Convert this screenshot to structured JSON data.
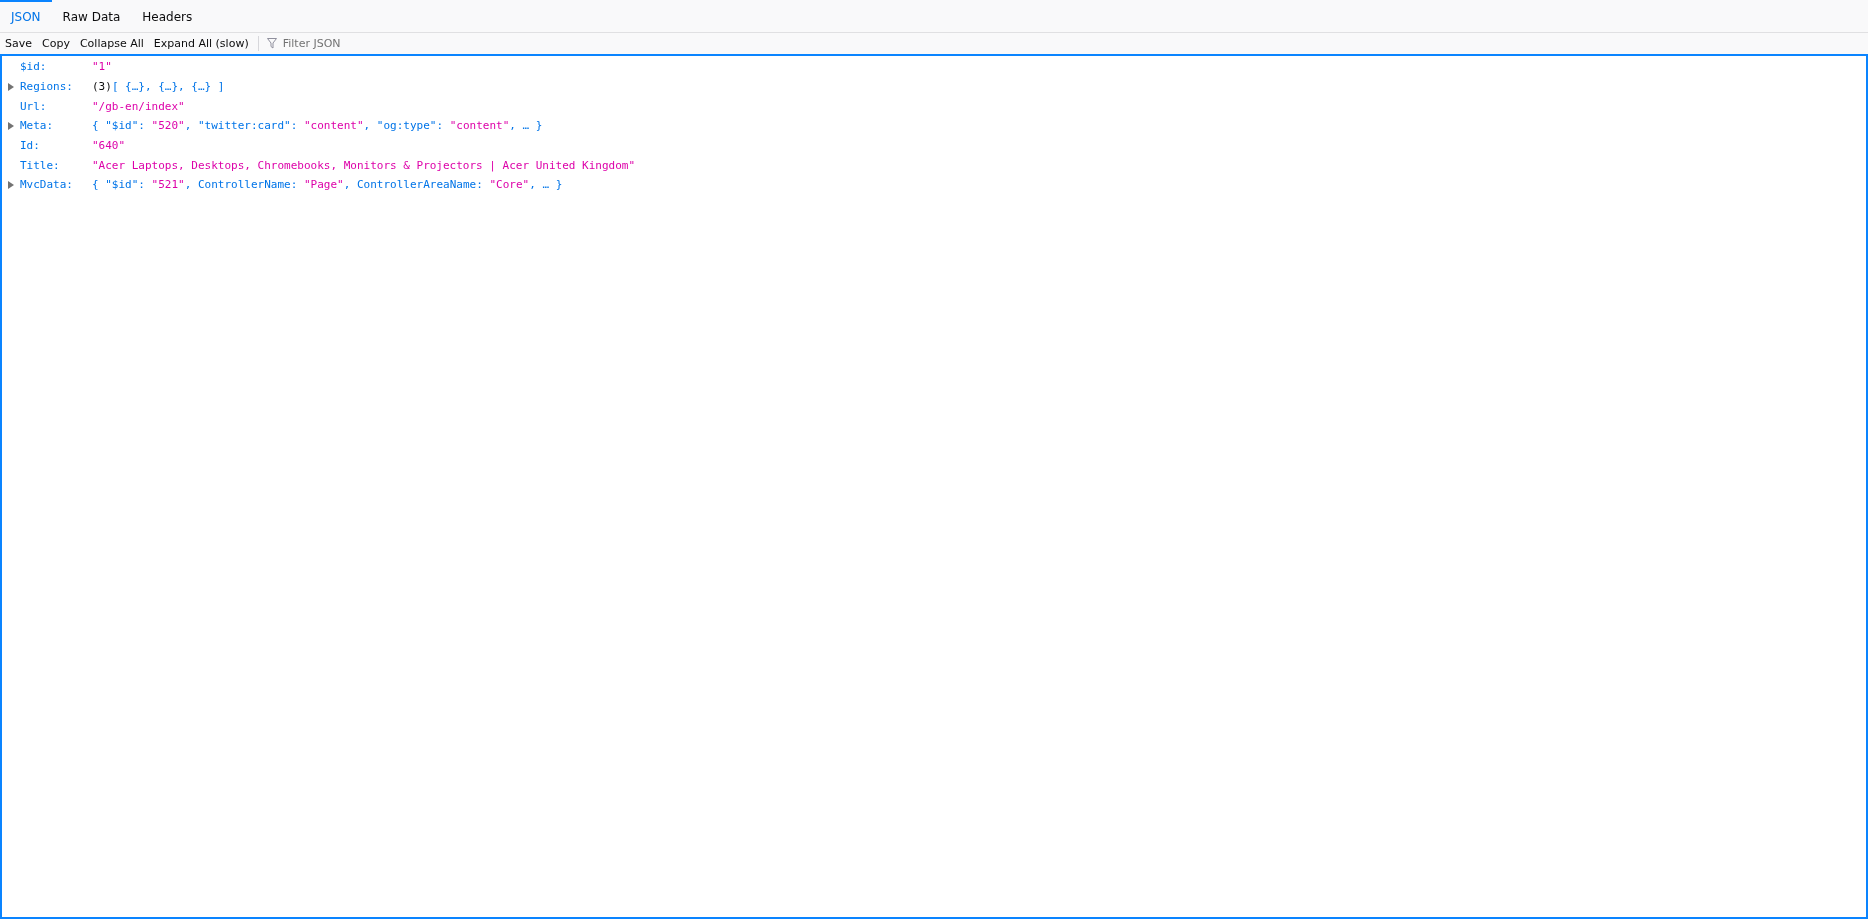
{
  "tabs": [
    {
      "label": "JSON",
      "selected": true
    },
    {
      "label": "Raw Data",
      "selected": false
    },
    {
      "label": "Headers",
      "selected": false
    }
  ],
  "toolbar": {
    "buttons": [
      "Save",
      "Copy",
      "Collapse All",
      "Expand All (slow)"
    ],
    "filter": {
      "placeholder": "Filter JSON"
    }
  },
  "rows": [
    {
      "key": "$id:",
      "kind": "leaf",
      "value": [
        {
          "kind": "string",
          "text": "\"1\""
        }
      ]
    },
    {
      "key": "Regions:",
      "kind": "object",
      "expanded": false,
      "value": [
        {
          "kind": "plain",
          "text": "(3)"
        },
        {
          "kind": "punct",
          "text": "[ {…}, {…}, {…} ]"
        }
      ]
    },
    {
      "key": "Url:",
      "kind": "leaf",
      "value": [
        {
          "kind": "string",
          "text": "\"/gb-en/index\""
        }
      ]
    },
    {
      "key": "Meta:",
      "kind": "object",
      "expanded": false,
      "value": [
        {
          "kind": "punct",
          "text": "{ \"$id\": "
        },
        {
          "kind": "string",
          "text": "\"520\""
        },
        {
          "kind": "punct",
          "text": ", \"twitter:card\": "
        },
        {
          "kind": "string",
          "text": "\"content\""
        },
        {
          "kind": "punct",
          "text": ", \"og:type\": "
        },
        {
          "kind": "string",
          "text": "\"content\""
        },
        {
          "kind": "punct",
          "text": ", … }"
        }
      ]
    },
    {
      "key": "Id:",
      "kind": "leaf",
      "value": [
        {
          "kind": "string",
          "text": "\"640\""
        }
      ]
    },
    {
      "key": "Title:",
      "kind": "leaf",
      "value": [
        {
          "kind": "string",
          "text": "\"Acer Laptops, Desktops, Chromebooks, Monitors & Projectors | Acer United Kingdom\""
        }
      ]
    },
    {
      "key": "MvcData:",
      "kind": "object",
      "expanded": false,
      "value": [
        {
          "kind": "punct",
          "text": "{ \"$id\": "
        },
        {
          "kind": "string",
          "text": "\"521\""
        },
        {
          "kind": "punct",
          "text": ", ControllerName: "
        },
        {
          "kind": "string",
          "text": "\"Page\""
        },
        {
          "kind": "punct",
          "text": ", ControllerAreaName: "
        },
        {
          "kind": "string",
          "text": "\"Core\""
        },
        {
          "kind": "punct",
          "text": ", … }"
        }
      ]
    }
  ]
}
